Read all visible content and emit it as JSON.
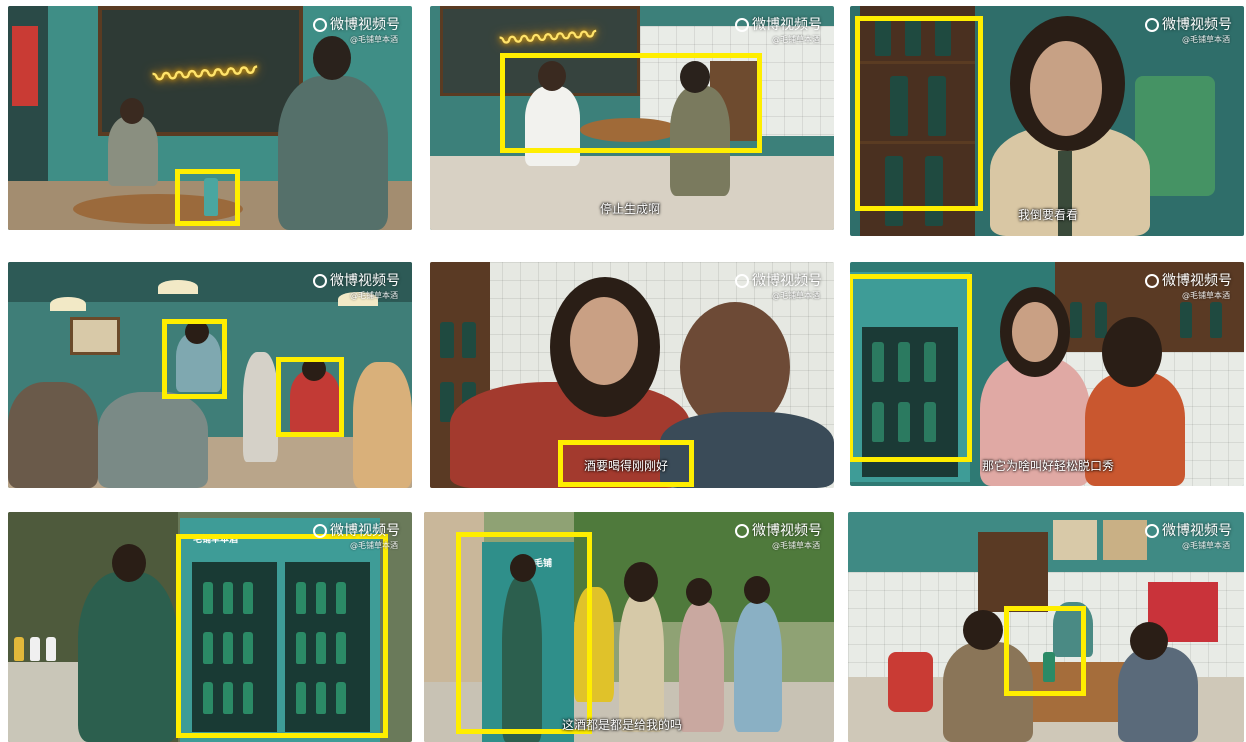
{
  "watermark": {
    "brand": "微博视频号",
    "sub": "@毛铺草本酒"
  },
  "frames": [
    {
      "id": 1,
      "subtitle": ""
    },
    {
      "id": 2,
      "subtitle": "停止生成啊"
    },
    {
      "id": 3,
      "subtitle": "我倒要看看"
    },
    {
      "id": 4,
      "subtitle": ""
    },
    {
      "id": 5,
      "subtitle": "酒要喝得刚刚好"
    },
    {
      "id": 6,
      "subtitle": "那它为啥叫好轻松脱口秀"
    },
    {
      "id": 7,
      "subtitle": ""
    },
    {
      "id": 8,
      "subtitle": "这酒都是都是给我的吗"
    },
    {
      "id": 9,
      "subtitle": ""
    }
  ],
  "fridge_label": "毛铺草本酒",
  "fridge_label_short": "毛铺",
  "colors": {
    "highlight": "#ffee00",
    "teal_wall": "#2e8b84",
    "bottle_green": "#1f6b55"
  }
}
